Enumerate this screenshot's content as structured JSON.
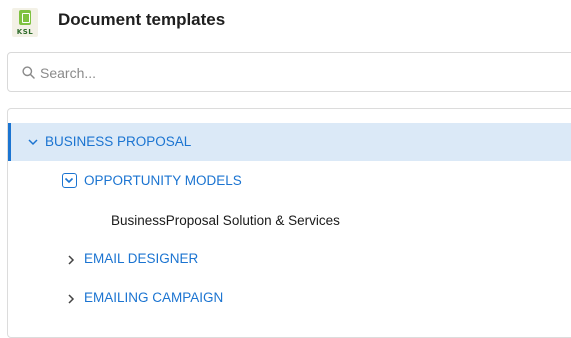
{
  "header": {
    "logo_text": "KSL",
    "title": "Document templates"
  },
  "search": {
    "placeholder": "Search..."
  },
  "tree": {
    "items": [
      {
        "label": "BUSINESS PROPOSAL",
        "state": "expanded",
        "selected": true
      },
      {
        "label": "OPPORTUNITY MODELS",
        "state": "expanded",
        "focused": true
      },
      {
        "label": "BusinessProposal Solution & Services",
        "type": "leaf"
      },
      {
        "label": "EMAIL DESIGNER",
        "state": "collapsed"
      },
      {
        "label": "EMAILING CAMPAIGN",
        "state": "collapsed"
      }
    ]
  },
  "colors": {
    "accent": "#1b74d1",
    "selected_background": "#dbe9f7"
  }
}
